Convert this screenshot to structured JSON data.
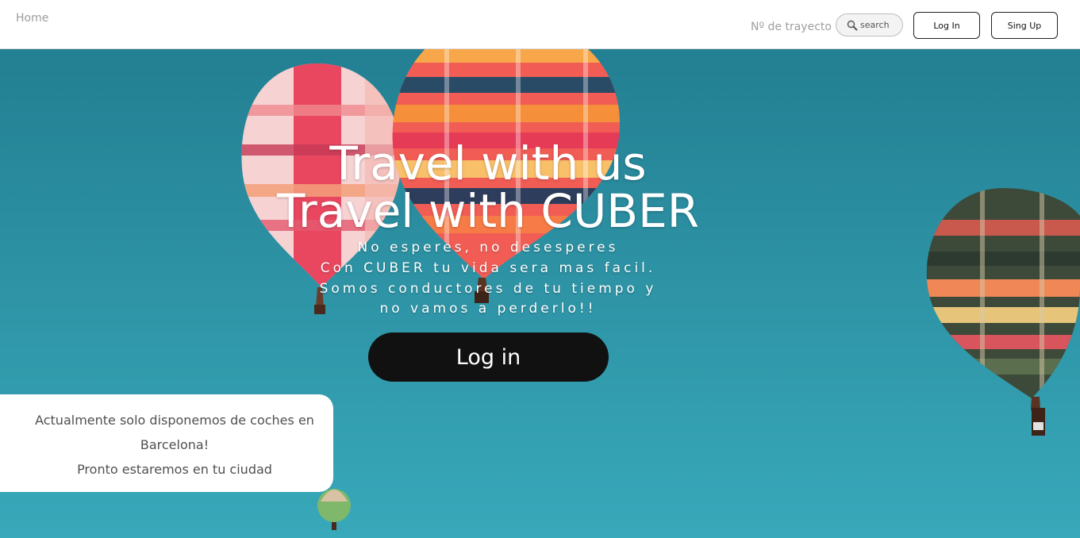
{
  "nav": {
    "home": "Home",
    "trayecto": "Nº de trayecto",
    "search_placeholder": "search",
    "login": "Log In",
    "signup": "Sing Up"
  },
  "hero": {
    "title_line1": "Travel with us",
    "title_line2": "Travel with CUBER",
    "subtitle_lines": [
      "No esperes, no desesperes",
      "Con CUBER tu vida sera mas facil.",
      "Somos conductores de tu tiempo y",
      "no vamos a perderlo!!"
    ],
    "login_button": "Log in"
  },
  "notice": {
    "line1": "Actualmente solo disponemos de coches en",
    "line2": "Barcelona!",
    "line3": "Pronto estaremos en tu ciudad"
  },
  "colors": {
    "sky": "#2f9fb1",
    "button_dark": "#111111",
    "nav_bg": "#ffffff"
  },
  "icons": {
    "search": "magnifier-icon"
  }
}
